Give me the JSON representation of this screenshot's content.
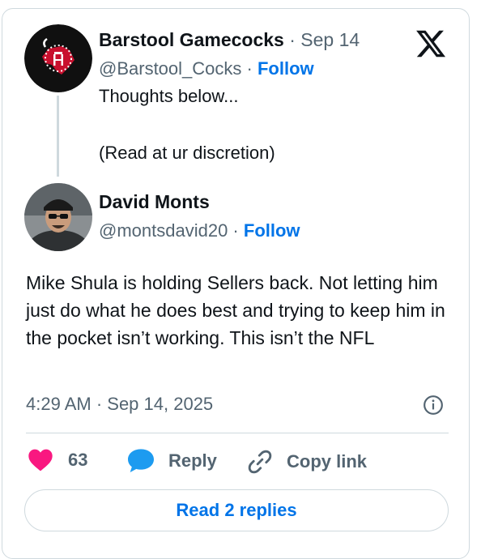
{
  "quoted": {
    "name": "Barstool Gamecocks",
    "separator": " · ",
    "date": "Sep 14",
    "handle": "@Barstool_Cocks",
    "follow": "Follow",
    "text_line1": "Thoughts below...",
    "text_line2": "(Read at ur discretion)"
  },
  "reply_tweet": {
    "name": "David Monts",
    "handle": "@montsdavid20",
    "follow": "Follow",
    "body": "Mike Shula is holding Sellers back. Not letting him just do what he does best and trying to keep him in the pocket isn’t working. This isn’t the NFL",
    "timestamp": "4:29 AM · Sep 14, 2025"
  },
  "actions": {
    "like_count": "63",
    "reply_label": "Reply",
    "copy_label": "Copy link"
  },
  "read_replies": "Read 2 replies",
  "colors": {
    "accent": "#0074e8",
    "like": "#f91880",
    "reply": "#1d9bf0",
    "secondary_text": "#536471",
    "border": "#cfd9de",
    "avatar_bg": "#101010",
    "avatar_red": "#c8102e"
  },
  "icons": [
    "x-logo-icon",
    "info-icon",
    "heart-icon",
    "speech-bubble-icon",
    "link-icon"
  ]
}
